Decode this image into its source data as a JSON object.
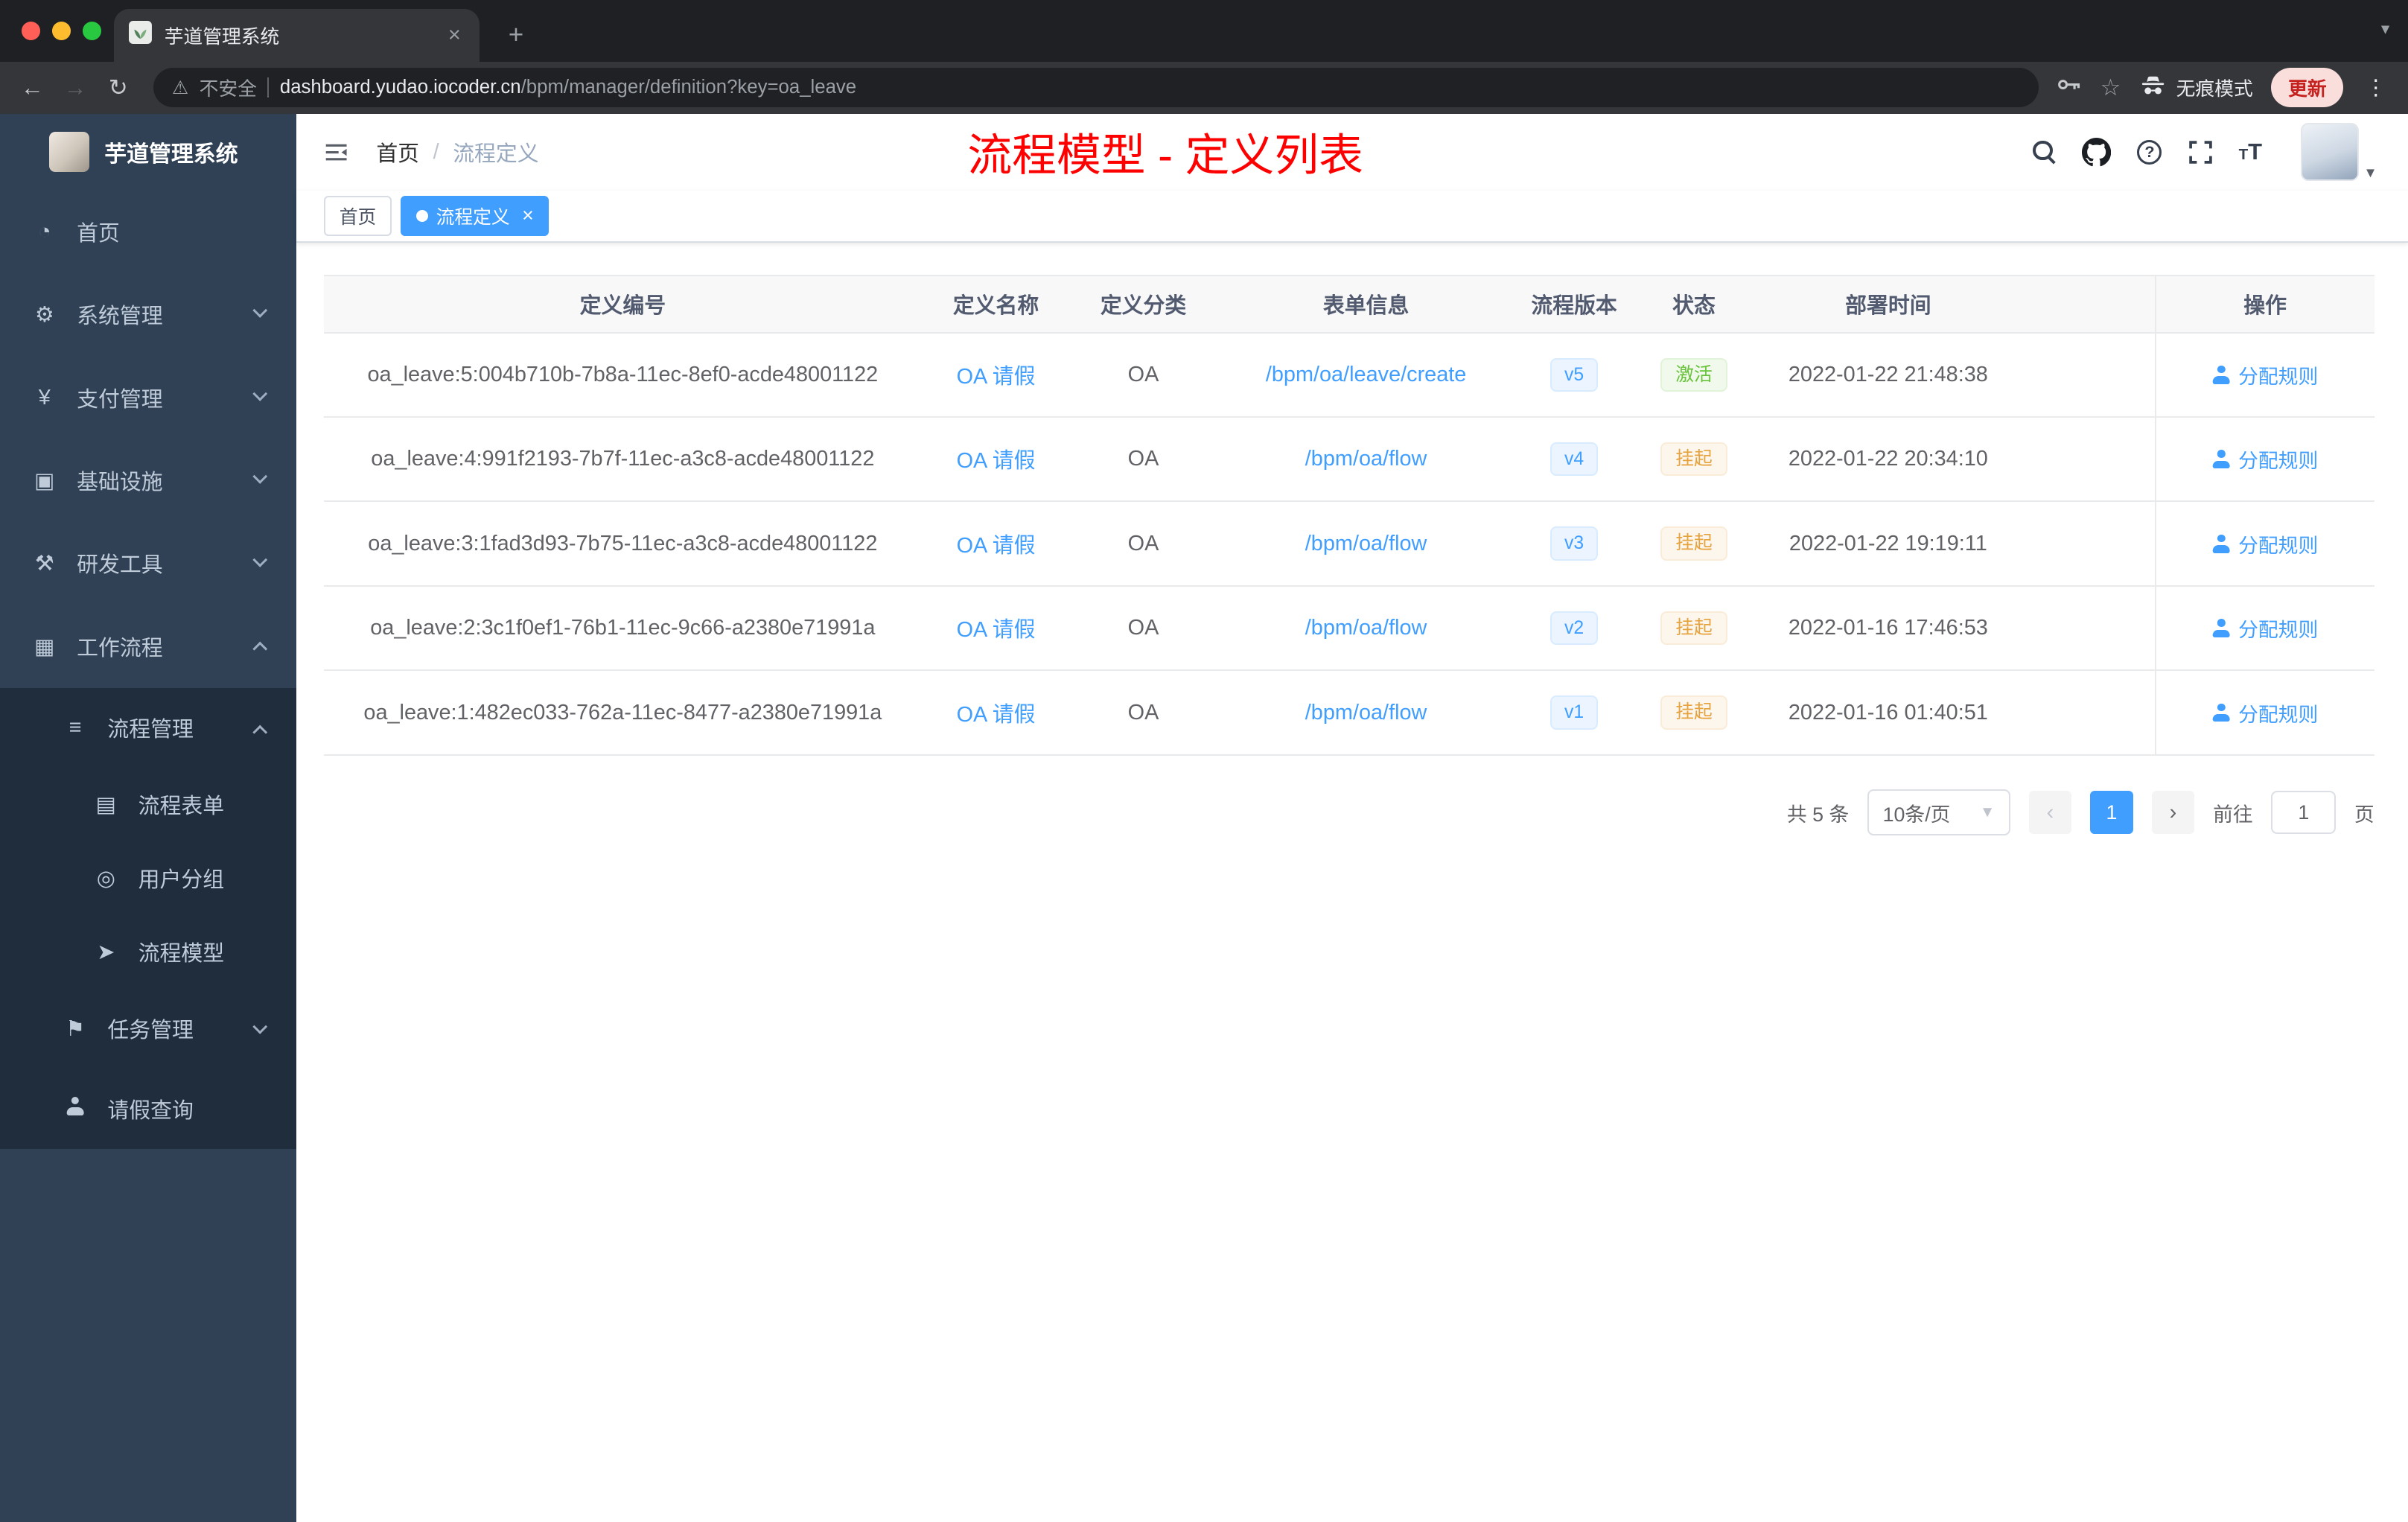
{
  "browser": {
    "tab": {
      "title": "芋道管理系统",
      "close": "×",
      "new_tab": "+"
    },
    "toolbar": {
      "security_label": "不安全",
      "url_domain": "dashboard.yudao.iocoder.cn",
      "url_path": "/bpm/manager/definition?key=oa_leave",
      "incognito_label": "无痕模式",
      "update_label": "更新"
    }
  },
  "sidebar": {
    "brand": "芋道管理系统",
    "items": [
      {
        "label": "首页",
        "icon": "dashboard-icon"
      },
      {
        "label": "系统管理",
        "icon": "gear-icon"
      },
      {
        "label": "支付管理",
        "icon": "yen-icon"
      },
      {
        "label": "基础设施",
        "icon": "infrastructure-icon"
      },
      {
        "label": "研发工具",
        "icon": "tools-icon"
      },
      {
        "label": "工作流程",
        "icon": "workflow-icon"
      },
      {
        "label": "流程管理",
        "icon": "list-icon"
      },
      {
        "label": "流程表单",
        "icon": "form-icon"
      },
      {
        "label": "用户分组",
        "icon": "user-group-icon"
      },
      {
        "label": "流程模型",
        "icon": "send-icon"
      },
      {
        "label": "任务管理",
        "icon": "task-icon"
      },
      {
        "label": "请假查询",
        "icon": "person-icon"
      }
    ]
  },
  "header": {
    "breadcrumb": {
      "home": "首页",
      "sep": "/",
      "current": "流程定义"
    },
    "annotation": "流程模型 - 定义列表"
  },
  "tags": {
    "home": "首页",
    "active": "流程定义",
    "close": "×"
  },
  "table": {
    "columns": [
      "定义编号",
      "定义名称",
      "定义分类",
      "表单信息",
      "流程版本",
      "状态",
      "部署时间",
      "操作"
    ],
    "action_label": "分配规则",
    "rows": [
      {
        "id": "oa_leave:5:004b710b-7b8a-11ec-8ef0-acde48001122",
        "name": "OA 请假",
        "category": "OA",
        "form": "/bpm/oa/leave/create",
        "version": "v5",
        "status": "激活",
        "status_type": "success",
        "time": "2022-01-22 21:48:38"
      },
      {
        "id": "oa_leave:4:991f2193-7b7f-11ec-a3c8-acde48001122",
        "name": "OA 请假",
        "category": "OA",
        "form": "/bpm/oa/flow",
        "version": "v4",
        "status": "挂起",
        "status_type": "warning",
        "time": "2022-01-22 20:34:10"
      },
      {
        "id": "oa_leave:3:1fad3d93-7b75-11ec-a3c8-acde48001122",
        "name": "OA 请假",
        "category": "OA",
        "form": "/bpm/oa/flow",
        "version": "v3",
        "status": "挂起",
        "status_type": "warning",
        "time": "2022-01-22 19:19:11"
      },
      {
        "id": "oa_leave:2:3c1f0ef1-76b1-11ec-9c66-a2380e71991a",
        "name": "OA 请假",
        "category": "OA",
        "form": "/bpm/oa/flow",
        "version": "v2",
        "status": "挂起",
        "status_type": "warning",
        "time": "2022-01-16 17:46:53"
      },
      {
        "id": "oa_leave:1:482ec033-762a-11ec-8477-a2380e71991a",
        "name": "OA 请假",
        "category": "OA",
        "form": "/bpm/oa/flow",
        "version": "v1",
        "status": "挂起",
        "status_type": "warning",
        "time": "2022-01-16 01:40:51"
      }
    ]
  },
  "pagination": {
    "total": "共 5 条",
    "page_size": "10条/页",
    "page": "1",
    "goto": "前往",
    "goto_value": "1",
    "unit": "页"
  }
}
